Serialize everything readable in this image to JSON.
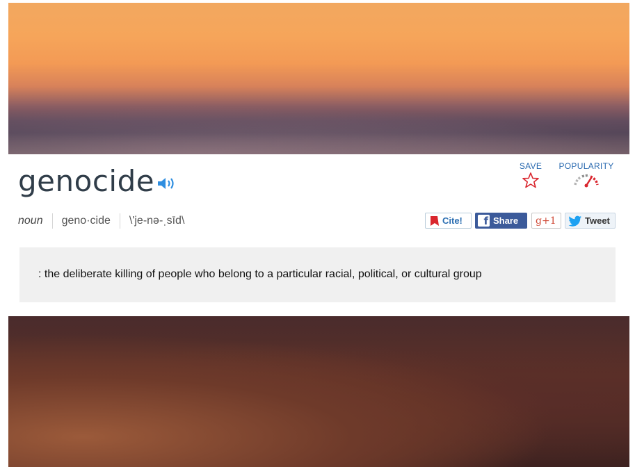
{
  "entry": {
    "word": "genocide",
    "part_of_speech": "noun",
    "syllables": "geno·cide",
    "pronunciation": "\\'je-nə-ˌsīd\\",
    "definition": ": the deliberate killing of people who belong to a particular racial, political, or cultural group"
  },
  "actions": {
    "save_label": "SAVE",
    "popularity_label": "POPULARITY"
  },
  "share": {
    "cite_label": "Cite!",
    "facebook_label": "Share",
    "gplus_label": "g+1",
    "twitter_label": "Tweet"
  },
  "colors": {
    "word": "#303d49",
    "link_blue": "#2a6ab0",
    "speaker_blue": "#2f8ee0",
    "facebook": "#3b5a9a",
    "cite_red": "#d9262e",
    "twitter": "#1da1f2"
  },
  "icons": [
    "speaker-icon",
    "star-icon",
    "popularity-gauge-icon",
    "bookmark-icon",
    "facebook-icon",
    "twitter-bird-icon"
  ]
}
